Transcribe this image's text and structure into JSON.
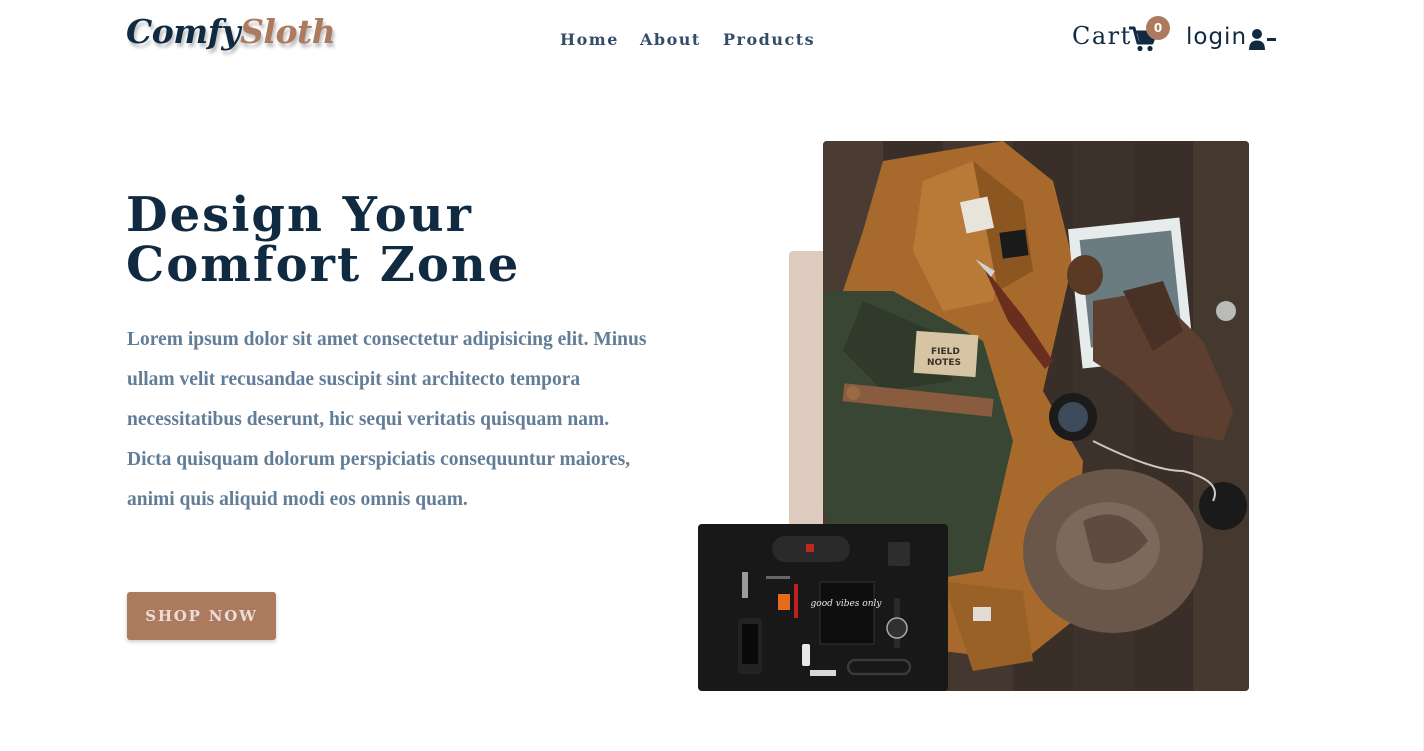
{
  "nav": {
    "logo_part1": "Comfy",
    "logo_part2": "Sloth",
    "links": [
      "Home",
      "About",
      "Products"
    ],
    "cart_label": "Cart",
    "cart_count": "0",
    "login_label": "login"
  },
  "hero": {
    "title_line1": "Design Your",
    "title_line2": "Comfort Zone",
    "text": "Lorem ipsum dolor sit amet consectetur adipisicing elit. Minus ullam velit recusandae suscipit sint architecto tempora necessitatibus deserunt, hic sequi veritatis quisquam nam. Dicta quisquam dolorum perspiciatis consequuntur maiores, animi quis aliquid modi eos omnis quam.",
    "button_label": "SHOP NOW",
    "field_notes_line1": "FIELD",
    "field_notes_line2": "NOTES",
    "notebook_text": "good vibes only"
  },
  "colors": {
    "primary": "#ab7a5f",
    "dark": "#102a42",
    "nav_text": "#324d67",
    "body_text": "#617d98",
    "accent_block": "#decbc0"
  }
}
